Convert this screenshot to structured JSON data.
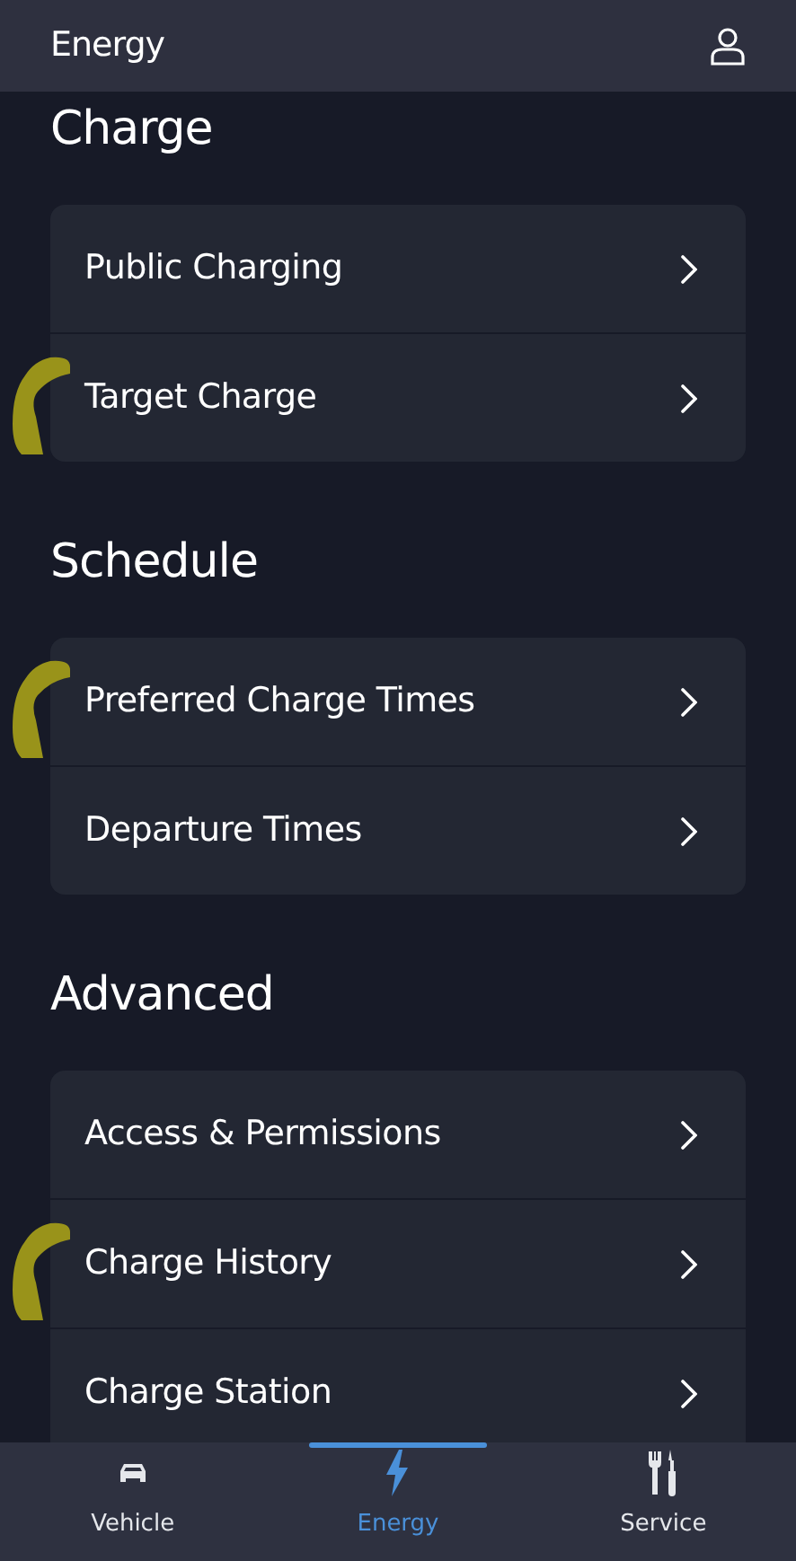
{
  "header": {
    "title": "Energy"
  },
  "sections": [
    {
      "title": "Charge",
      "items": [
        {
          "label": "Public Charging",
          "marked": false
        },
        {
          "label": "Target Charge",
          "marked": true
        }
      ]
    },
    {
      "title": "Schedule",
      "items": [
        {
          "label": "Preferred Charge Times",
          "marked": true
        },
        {
          "label": "Departure Times",
          "marked": false
        }
      ]
    },
    {
      "title": "Advanced",
      "items": [
        {
          "label": "Access & Permissions",
          "marked": false
        },
        {
          "label": "Charge History",
          "marked": true
        },
        {
          "label": "Charge Station",
          "marked": false
        }
      ]
    }
  ],
  "nav": [
    {
      "label": "Vehicle",
      "kind": "vehicle",
      "selected": false
    },
    {
      "label": "Energy",
      "kind": "energy",
      "selected": true
    },
    {
      "label": "Service",
      "kind": "service",
      "selected": false
    }
  ]
}
